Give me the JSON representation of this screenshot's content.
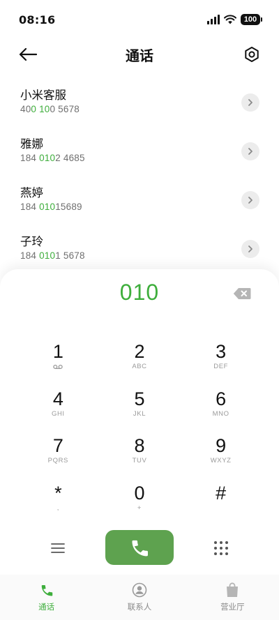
{
  "status_bar": {
    "time": "08:16",
    "battery": "100"
  },
  "header": {
    "title": "通话"
  },
  "contacts": [
    {
      "name": "小米客服",
      "number_parts": [
        "40",
        "0 10",
        "0 5678"
      ]
    },
    {
      "name": "雅娜",
      "number_parts": [
        "184 ",
        "010",
        "2 4685"
      ]
    },
    {
      "name": "燕婷",
      "number_parts": [
        "184 ",
        "010",
        "15689"
      ]
    },
    {
      "name": "子玲",
      "number_parts": [
        "184 ",
        "010",
        "1 5678"
      ]
    }
  ],
  "dialer": {
    "number": "010",
    "keys": [
      {
        "digit": "1",
        "letters": "",
        "icon": "voicemail-icon"
      },
      {
        "digit": "2",
        "letters": "ABC"
      },
      {
        "digit": "3",
        "letters": "DEF"
      },
      {
        "digit": "4",
        "letters": "GHI"
      },
      {
        "digit": "5",
        "letters": "JKL"
      },
      {
        "digit": "6",
        "letters": "MNO"
      },
      {
        "digit": "7",
        "letters": "PQRS"
      },
      {
        "digit": "8",
        "letters": "TUV"
      },
      {
        "digit": "9",
        "letters": "WXYZ"
      },
      {
        "digit": "*",
        "letters": ","
      },
      {
        "digit": "0",
        "letters": "+"
      },
      {
        "digit": "#",
        "letters": ""
      }
    ]
  },
  "bottom_nav": [
    {
      "label": "通话",
      "icon": "phone-icon",
      "active": true
    },
    {
      "label": "联系人",
      "icon": "contact-icon",
      "active": false
    },
    {
      "label": "营业厅",
      "icon": "shopping-bag-icon",
      "active": false
    }
  ],
  "colors": {
    "accent": "#3eae3c",
    "call_button": "#5ea24f"
  }
}
